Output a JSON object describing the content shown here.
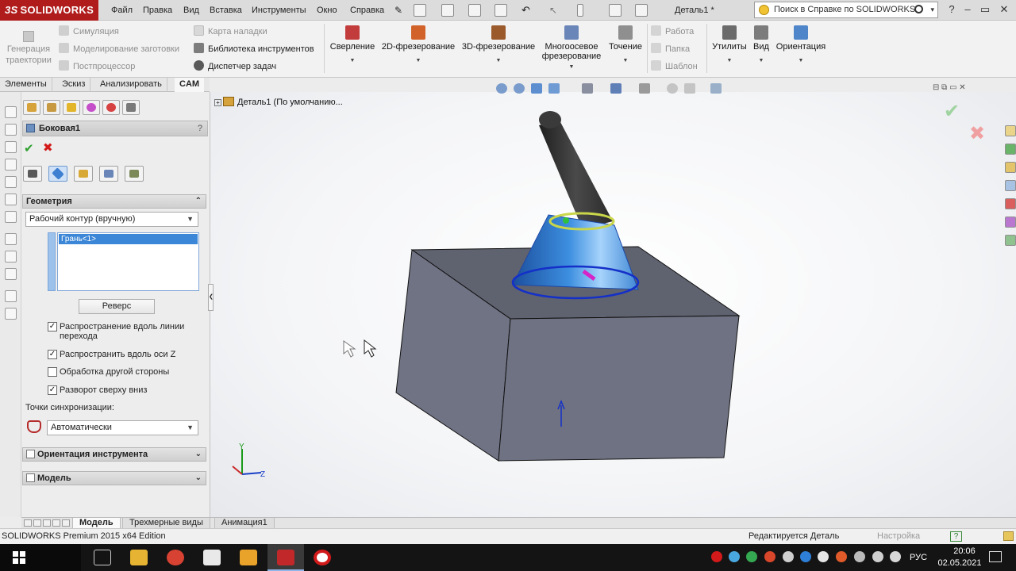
{
  "app": {
    "brand_prefix": "3S",
    "brand": "SOLIDWORKS",
    "doc_title": "Деталь1 *",
    "help_search_placeholder": "Поиск в Справке по SOLIDWORKS"
  },
  "menu": [
    "Файл",
    "Правка",
    "Вид",
    "Вставка",
    "Инструменты",
    "Окно",
    "Справка"
  ],
  "ribbon": {
    "gen_line1": "Генерация",
    "gen_line2": "траектории",
    "simulation": "Симуляция",
    "stock_modeling": "Моделирование заготовки",
    "postprocessor": "Постпроцессор",
    "setup_sheet": "Карта наладки",
    "tool_library": "Библиотека инструментов",
    "task_manager": "Диспетчер задач",
    "drilling": "Сверление",
    "milling_2d": "2D-фрезерование",
    "milling_3d": "3D-фрезерование",
    "multiaxis_line1": "Многоосевое",
    "multiaxis_line2": "фрезерование",
    "turning": "Точение",
    "job": "Работа",
    "folder": "Папка",
    "template": "Шаблон",
    "utilities": "Утилиты",
    "view": "Вид",
    "orientation": "Ориентация"
  },
  "tabs": [
    "Элементы",
    "Эскиз",
    "Анализировать",
    "CAM"
  ],
  "active_tab": "CAM",
  "pm": {
    "title": "Боковая1",
    "help": "?",
    "geometry_group": "Геометрия",
    "contour_select": "Рабочий контур (вручную)",
    "selection_item": "Грань<1>",
    "reverse_button": "Реверс",
    "opt_propagate_transition": "Распространение вдоль линии перехода",
    "opt_propagate_z": "Распространить вдоль оси Z",
    "opt_other_side": "Обработка другой стороны",
    "opt_top_down": "Разворот сверху вниз",
    "sync_label": "Точки синхронизации:",
    "sync_select": "Автоматически",
    "tool_orientation_group": "Ориентация инструмента",
    "model_group": "Модель"
  },
  "checkboxes": {
    "propagate_transition": true,
    "propagate_z": true,
    "other_side": false,
    "top_down": true
  },
  "check_glyph": "✓",
  "viewport": {
    "tree_root": "Деталь1  (По умолчанию...",
    "axis_y": "Y",
    "axis_z": "Z"
  },
  "bottom_tabs": [
    "Модель",
    "Трехмерные виды",
    "Анимация1"
  ],
  "status": {
    "edition": "SOLIDWORKS Premium 2015 x64 Edition",
    "editing": "Редактируется Деталь",
    "settings": "Настройка",
    "help": "?"
  },
  "taskbar": {
    "lang": "РУС",
    "time": "20:06",
    "date": "02.05.2021"
  },
  "colors": {
    "brand_red": "#b01c1c",
    "selection_blue": "#3b86d6",
    "ok_green": "#2ea02e",
    "cancel_red": "#d21a1a",
    "box_face": "#6f7282",
    "cone_blue": "#3d8fe0"
  }
}
